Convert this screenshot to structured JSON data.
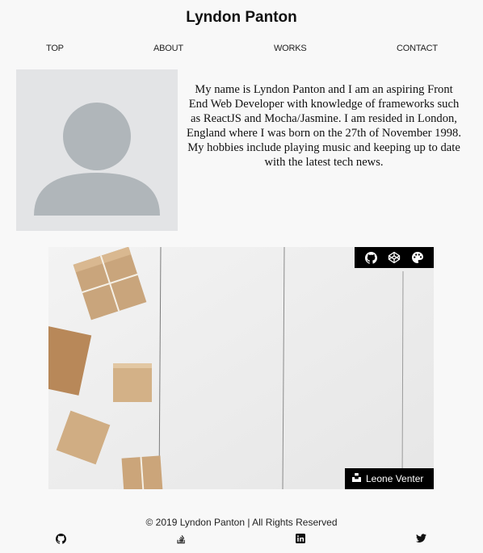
{
  "header": {
    "title": "Lyndon Panton"
  },
  "nav": {
    "items": [
      "TOP",
      "ABOUT",
      "WORKS",
      "CONTACT"
    ]
  },
  "about": {
    "bio": "My name is Lyndon Panton and I am an aspiring Front End Web Developer with knowledge of frameworks such as ReactJS and Mocha/Jasmine. I am resided in London, England where I was born on the 27th of November 1998. My hobbies include playing music and keeping up to date with the latest tech news."
  },
  "project": {
    "icons": [
      "github-icon",
      "codepen-icon",
      "palette-icon"
    ],
    "credit": "Leone Venter"
  },
  "footer": {
    "copyright": "© 2019 Lyndon Panton | All Rights Reserved",
    "social_icons": [
      "github-icon",
      "stack-overflow-icon",
      "linkedin-icon",
      "twitter-icon"
    ]
  },
  "colors": {
    "background": "#f8f8f8",
    "avatar_bg": "#e3e4e6",
    "avatar_fg": "#b0b6ba",
    "bar": "#000000"
  }
}
